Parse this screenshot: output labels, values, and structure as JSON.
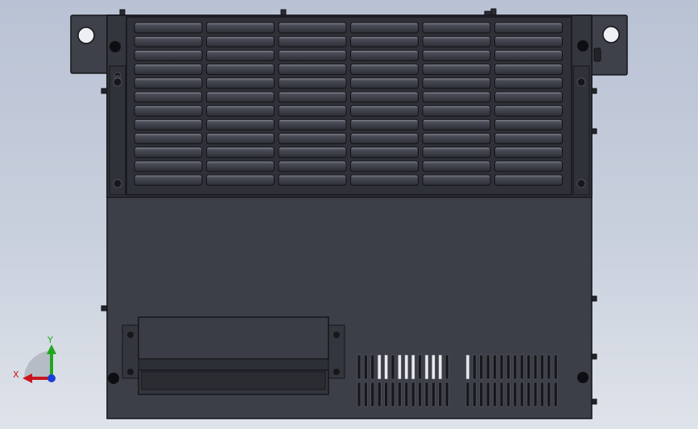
{
  "viewport": {
    "background_top": "#b9c2d4",
    "background_bottom": "#dfe3ea",
    "body_color": "#3c3f48",
    "edge_color": "#15171b"
  },
  "model": {
    "vent_grille": {
      "columns": 6,
      "rows": 12
    },
    "lower_vents": {
      "rows": 2,
      "left_slots": 14,
      "right_slots": 14
    }
  },
  "triad": {
    "x_label": "X",
    "y_label": "Y",
    "x_color": "#c8141c",
    "y_color": "#1fa81f",
    "z_color": "#1b3fd6"
  }
}
